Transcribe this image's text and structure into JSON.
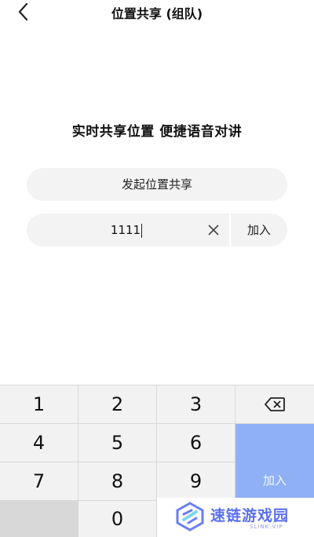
{
  "header": {
    "title": "位置共享 (组队)",
    "back_icon": "chevron-left-icon"
  },
  "main": {
    "subtitle": "实时共享位置 便捷语音对讲",
    "start_button": "发起位置共享",
    "code_value": "1111",
    "clear_icon": "close-icon",
    "join_button": "加入"
  },
  "keypad": {
    "keys": [
      "1",
      "2",
      "3",
      "4",
      "5",
      "6",
      "7",
      "8",
      "9",
      "0"
    ],
    "backspace_icon": "backspace-icon",
    "join_label": "加入",
    "accent_color": "#8fb0f5"
  },
  "watermark": {
    "text": "速链游戏园",
    "sub": "SLINK.VIP"
  }
}
